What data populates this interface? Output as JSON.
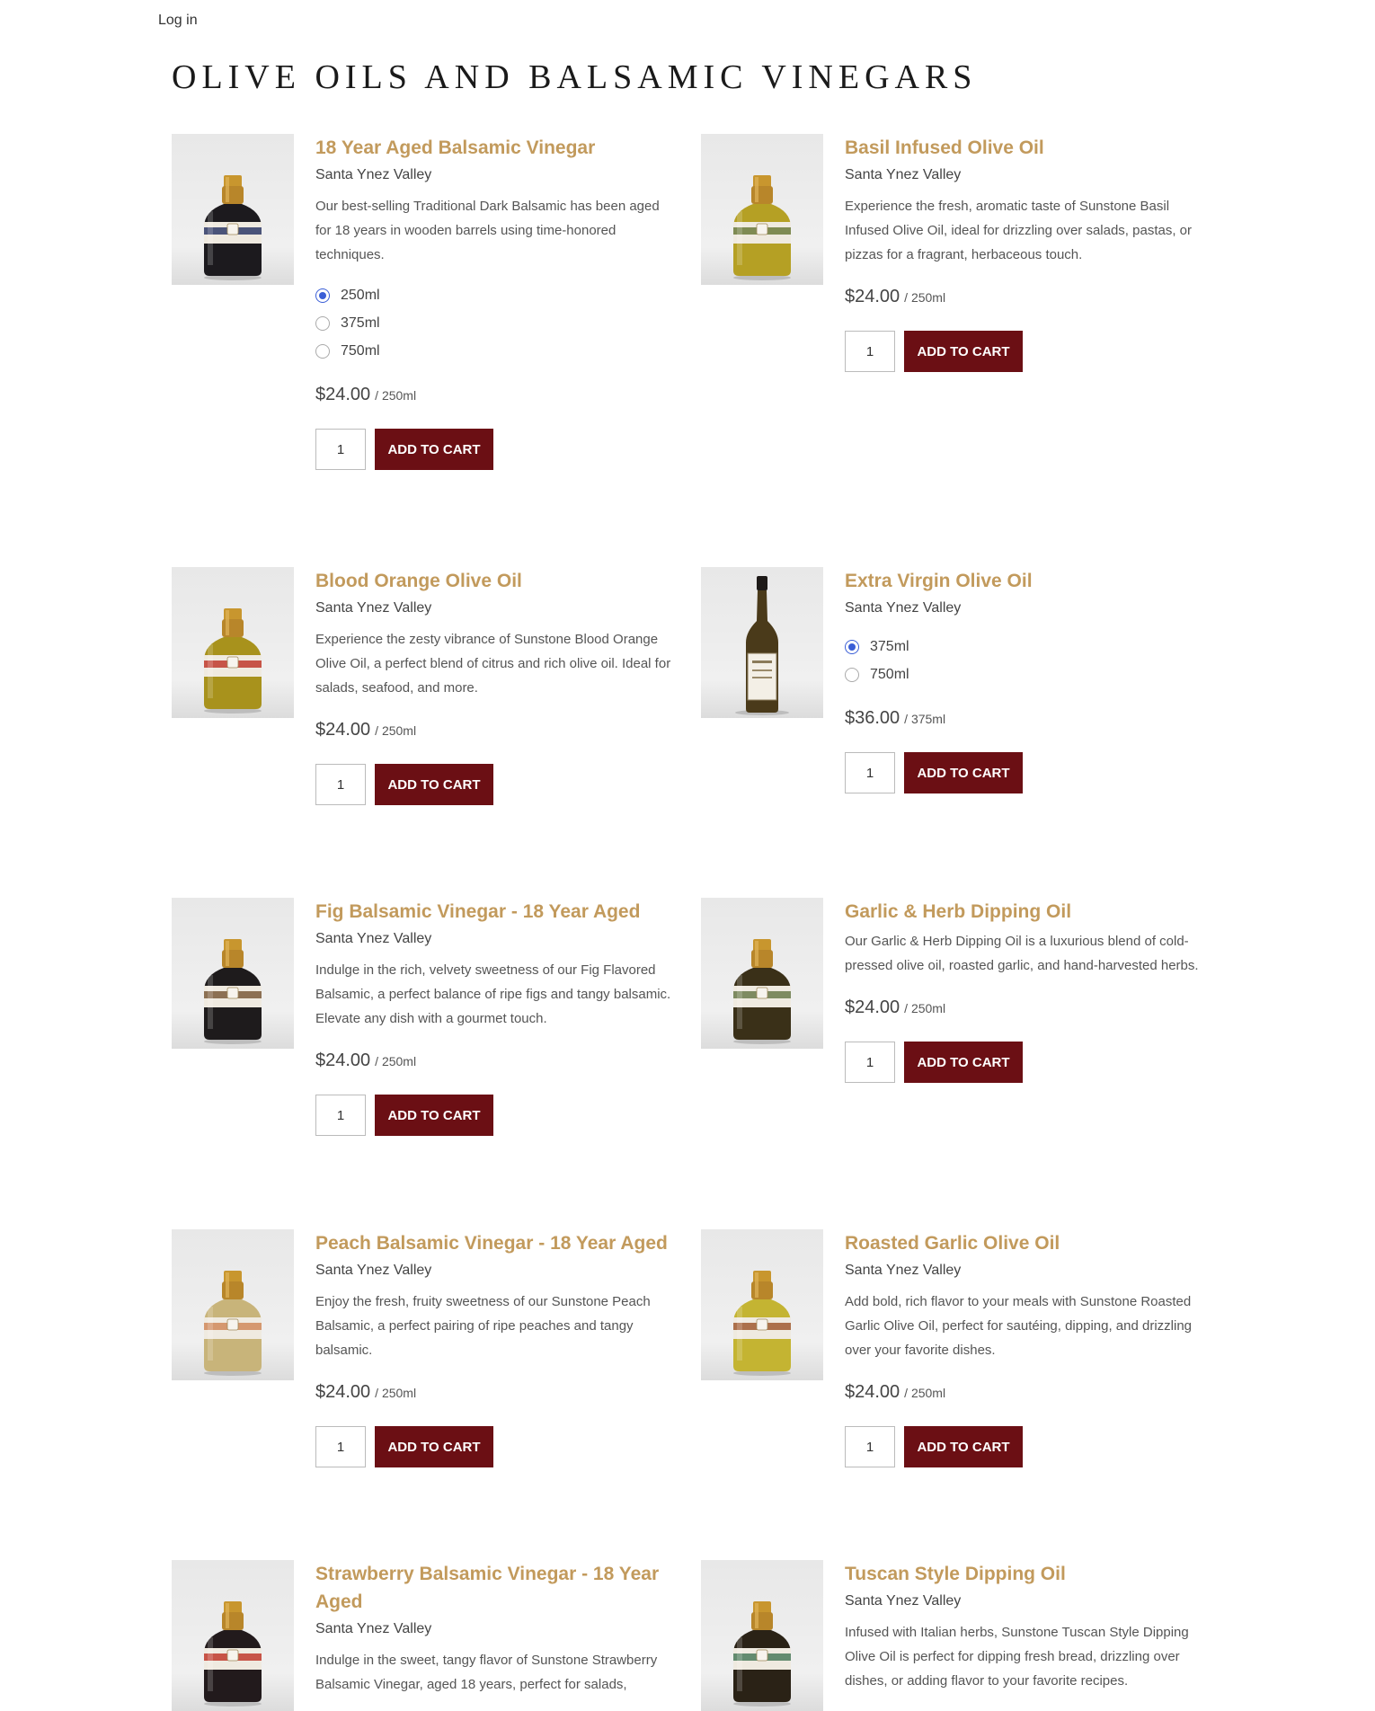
{
  "nav": {
    "login_label": "Log in"
  },
  "page": {
    "title": "OLIVE OILS AND BALSAMIC VINEGARS"
  },
  "colors": {
    "title_gold": "#c29a5c",
    "button_maroon": "#6b0f14",
    "radio_blue": "#3a5ed6"
  },
  "products": [
    {
      "name": "18 Year Aged Balsamic Vinegar",
      "origin": "Santa Ynez Valley",
      "description": "Our best-selling Traditional Dark Balsamic has been aged for 18 years in wooden barrels using time-honored techniques.",
      "sizes": [
        "250ml",
        "375ml",
        "750ml"
      ],
      "selected_size": "250ml",
      "price": "$24.00",
      "unit": "/ 250ml",
      "quantity": "1",
      "button_label": "ADD TO CART",
      "bottle": {
        "shape": "squat",
        "liquid": "#1c1a1e",
        "band": "#2e3a66"
      }
    },
    {
      "name": "Basil Infused Olive Oil",
      "origin": "Santa Ynez Valley",
      "description": "Experience the fresh, aromatic taste of Sunstone Basil Infused Olive Oil, ideal for drizzling over salads, pastas, or pizzas for a fragrant, herbaceous touch.",
      "sizes": [],
      "selected_size": "",
      "price": "$24.00",
      "unit": "/ 250ml",
      "quantity": "1",
      "button_label": "ADD TO CART",
      "bottle": {
        "shape": "squat",
        "liquid": "#b5a024",
        "band": "#6b7a3a"
      }
    },
    {
      "name": "Blood Orange Olive Oil",
      "origin": "Santa Ynez Valley",
      "description": "Experience the zesty vibrance of Sunstone Blood Orange Olive Oil, a perfect blend of citrus and rich olive oil. Ideal for salads, seafood, and more.",
      "sizes": [],
      "selected_size": "",
      "price": "$24.00",
      "unit": "/ 250ml",
      "quantity": "1",
      "button_label": "ADD TO CART",
      "bottle": {
        "shape": "squat",
        "liquid": "#a8921c",
        "band": "#c0392b"
      }
    },
    {
      "name": "Extra Virgin Olive Oil",
      "origin": "Santa Ynez Valley",
      "description": "",
      "sizes": [
        "375ml",
        "750ml"
      ],
      "selected_size": "375ml",
      "price": "$36.00",
      "unit": "/ 375ml",
      "quantity": "1",
      "button_label": "ADD TO CART",
      "bottle": {
        "shape": "tall",
        "liquid": "#4a3a1a",
        "band": "#8a7a5a"
      }
    },
    {
      "name": "Fig Balsamic Vinegar - 18 Year Aged",
      "origin": "Santa Ynez Valley",
      "description": "Indulge in the rich, velvety sweetness of our Fig Flavored Balsamic, a perfect balance of ripe figs and tangy balsamic. Elevate any dish with a gourmet touch.",
      "sizes": [],
      "selected_size": "",
      "price": "$24.00",
      "unit": "/ 250ml",
      "quantity": "1",
      "button_label": "ADD TO CART",
      "bottle": {
        "shape": "squat",
        "liquid": "#1e1b1c",
        "band": "#7a5a3a"
      }
    },
    {
      "name": "Garlic & Herb Dipping Oil",
      "origin": "",
      "description": "Our Garlic & Herb Dipping Oil is a luxurious blend of cold-pressed olive oil, roasted garlic, and hand-harvested herbs.",
      "sizes": [],
      "selected_size": "",
      "price": "$24.00",
      "unit": "/ 250ml",
      "quantity": "1",
      "button_label": "ADD TO CART",
      "bottle": {
        "shape": "squat",
        "liquid": "#3a3018",
        "band": "#6a7a4a"
      }
    },
    {
      "name": "Peach Balsamic Vinegar - 18 Year Aged",
      "origin": "Santa Ynez Valley",
      "description": "Enjoy the fresh, fruity sweetness of our Sunstone Peach Balsamic, a perfect pairing of ripe peaches and tangy balsamic.",
      "sizes": [],
      "selected_size": "",
      "price": "$24.00",
      "unit": "/ 250ml",
      "quantity": "1",
      "button_label": "ADD TO CART",
      "bottle": {
        "shape": "squat",
        "liquid": "#c8b47a",
        "band": "#d08a5a"
      }
    },
    {
      "name": "Roasted Garlic Olive Oil",
      "origin": "Santa Ynez Valley",
      "description": "Add bold, rich flavor to your meals with Sunstone Roasted Garlic Olive Oil, perfect for sautéing, dipping, and drizzling over your favorite dishes.",
      "sizes": [],
      "selected_size": "",
      "price": "$24.00",
      "unit": "/ 250ml",
      "quantity": "1",
      "button_label": "ADD TO CART",
      "bottle": {
        "shape": "squat",
        "liquid": "#c4b432",
        "band": "#a05a30"
      }
    },
    {
      "name": "Strawberry Balsamic Vinegar - 18 Year Aged",
      "origin": "Santa Ynez Valley",
      "description": "Indulge in the sweet, tangy flavor of Sunstone Strawberry Balsamic Vinegar, aged 18 years, perfect for salads,",
      "sizes": [],
      "selected_size": "",
      "price": "",
      "unit": "",
      "quantity": "",
      "button_label": "",
      "bottle": {
        "shape": "squat",
        "liquid": "#221a1c",
        "band": "#c0392b"
      }
    },
    {
      "name": "Tuscan Style Dipping Oil",
      "origin": "Santa Ynez Valley",
      "description": "Infused with Italian herbs, Sunstone Tuscan Style Dipping Olive Oil is perfect for dipping fresh bread, drizzling over dishes, or adding flavor to your favorite recipes.",
      "sizes": [],
      "selected_size": "",
      "price": "",
      "unit": "",
      "quantity": "",
      "button_label": "",
      "bottle": {
        "shape": "squat",
        "liquid": "#2a2216",
        "band": "#4a7a5a"
      }
    }
  ]
}
